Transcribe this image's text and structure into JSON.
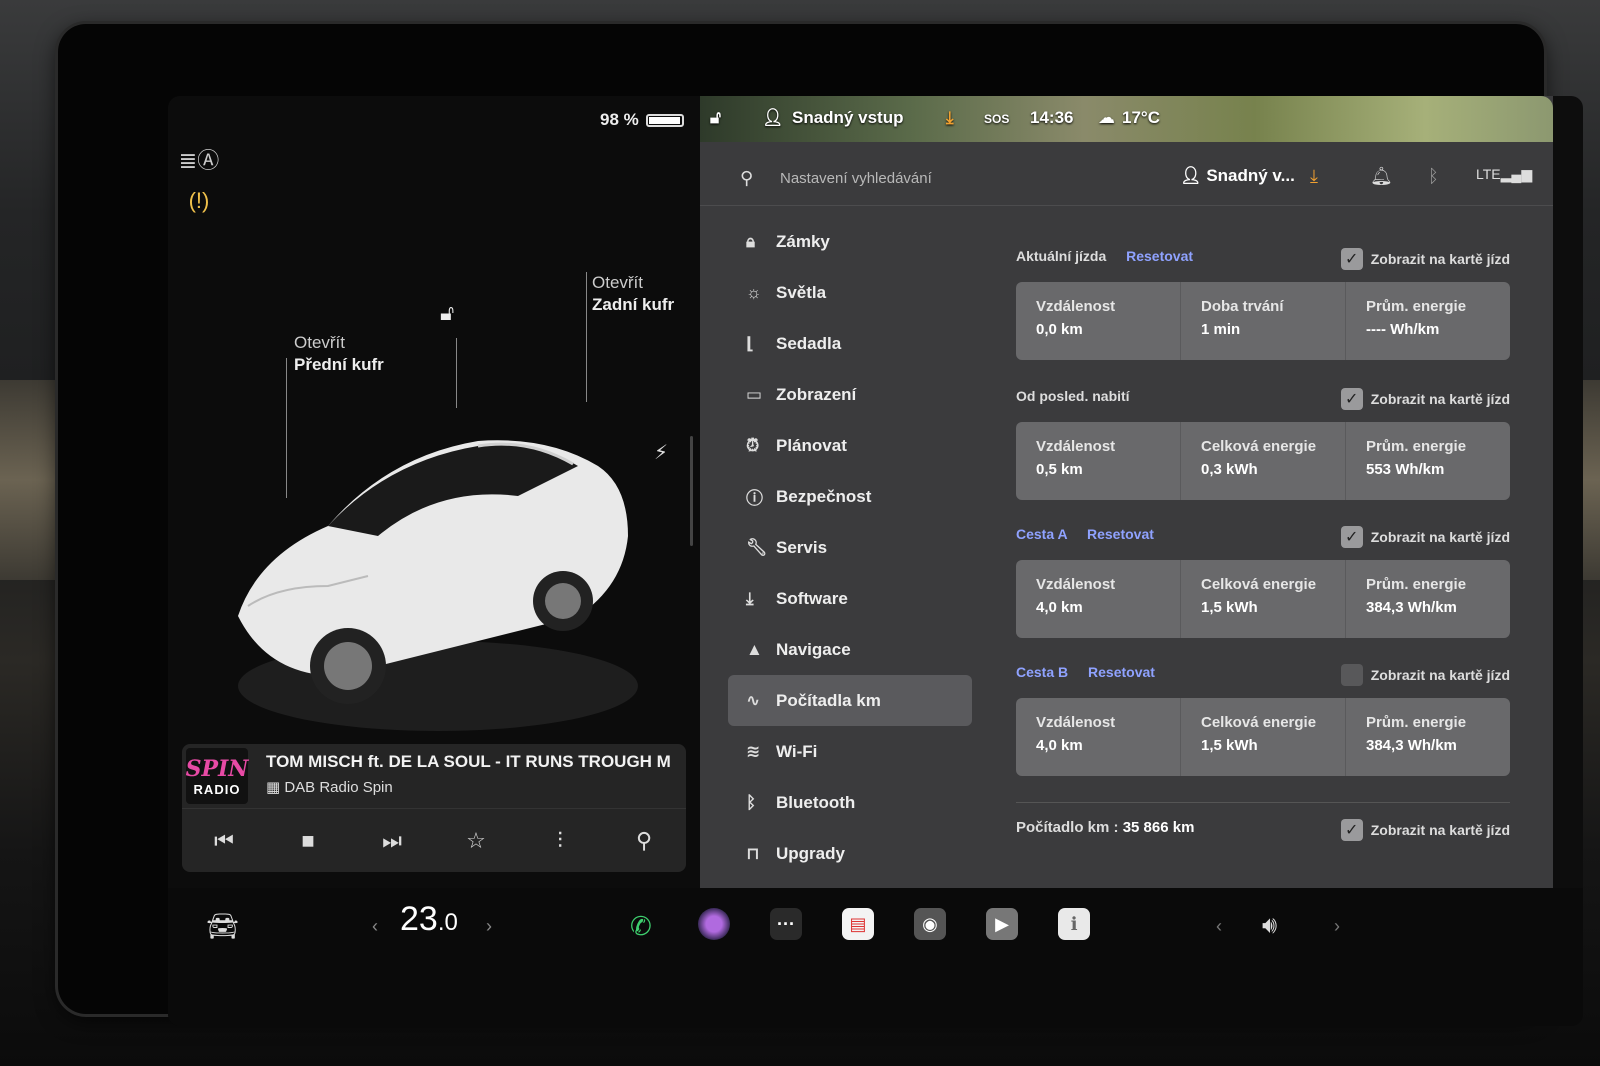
{
  "status": {
    "battery_pct": "98 %",
    "battery_level": 0.98
  },
  "car_panel": {
    "front_trunk": {
      "action": "Otevřít",
      "label": "Přední kufr"
    },
    "rear_trunk": {
      "action": "Otevřít",
      "label": "Zadní kufr"
    }
  },
  "media": {
    "logo_top": "SPIN",
    "logo_bottom": "RADIO",
    "song": "TOM MISCH ft. DE LA SOUL - IT RUNS TROUGH M",
    "station": "DAB Radio Spin",
    "controls": [
      "previous-icon",
      "stop-icon",
      "next-icon",
      "favorite-icon",
      "equalizer-icon",
      "search-icon"
    ]
  },
  "topbar": {
    "profile": "Snadný vstup",
    "time": "14:36",
    "temperature": "17°C",
    "sos": "SOS"
  },
  "search": {
    "placeholder": "Nastavení vyhledávání",
    "profile": "Snadný v..."
  },
  "menu": [
    {
      "label": "Zámky",
      "icon": "lock-icon"
    },
    {
      "label": "Světla",
      "icon": "sun-icon"
    },
    {
      "label": "Sedadla",
      "icon": "seat-icon"
    },
    {
      "label": "Zobrazení",
      "icon": "display-icon"
    },
    {
      "label": "Plánovat",
      "icon": "clock-icon"
    },
    {
      "label": "Bezpečnost",
      "icon": "alert-icon"
    },
    {
      "label": "Servis",
      "icon": "wrench-icon"
    },
    {
      "label": "Software",
      "icon": "download-icon"
    },
    {
      "label": "Navigace",
      "icon": "navigation-icon"
    },
    {
      "label": "Počítadla km",
      "icon": "odometer-icon",
      "selected": true
    },
    {
      "label": "Wi-Fi",
      "icon": "wifi-icon"
    },
    {
      "label": "Bluetooth",
      "icon": "bluetooth-icon"
    },
    {
      "label": "Upgrady",
      "icon": "bag-icon"
    }
  ],
  "trips": {
    "current": {
      "title": "Aktuální jízda",
      "reset": "Resetovat",
      "show": "Zobrazit na kartě jízd",
      "checked": true,
      "cells": [
        {
          "label": "Vzdálenost",
          "value": "0,0 km"
        },
        {
          "label": "Doba trvání",
          "value": "1 min"
        },
        {
          "label": "Prům. energie",
          "value": "---- Wh/km"
        }
      ]
    },
    "since_charge": {
      "title": "Od posled. nabití",
      "show": "Zobrazit na kartě jízd",
      "checked": true,
      "cells": [
        {
          "label": "Vzdálenost",
          "value": "0,5 km"
        },
        {
          "label": "Celková energie",
          "value": "0,3 kWh"
        },
        {
          "label": "Prům. energie",
          "value": "553 Wh/km"
        }
      ]
    },
    "trip_a": {
      "title": "Cesta A",
      "reset": "Resetovat",
      "show": "Zobrazit na kartě jízd",
      "checked": true,
      "cells": [
        {
          "label": "Vzdálenost",
          "value": "4,0 km"
        },
        {
          "label": "Celková energie",
          "value": "1,5 kWh"
        },
        {
          "label": "Prům. energie",
          "value": "384,3 Wh/km"
        }
      ]
    },
    "trip_b": {
      "title": "Cesta B",
      "reset": "Resetovat",
      "show": "Zobrazit na kartě jízd",
      "checked": false,
      "cells": [
        {
          "label": "Vzdálenost",
          "value": "4,0 km"
        },
        {
          "label": "Celková energie",
          "value": "1,5 kWh"
        },
        {
          "label": "Prům. energie",
          "value": "384,3 Wh/km"
        }
      ]
    },
    "odometer": {
      "label": "Počítadlo km :",
      "value": "35 866 km",
      "show": "Zobrazit na kartě jízd",
      "checked": true
    }
  },
  "bottom": {
    "temp_main": "23",
    "temp_decimal": ".0"
  },
  "colors": {
    "accent": "#8fa2ff",
    "panel": "#3b3b3d",
    "cell": "#69696b",
    "warning": "#f0c14b"
  }
}
